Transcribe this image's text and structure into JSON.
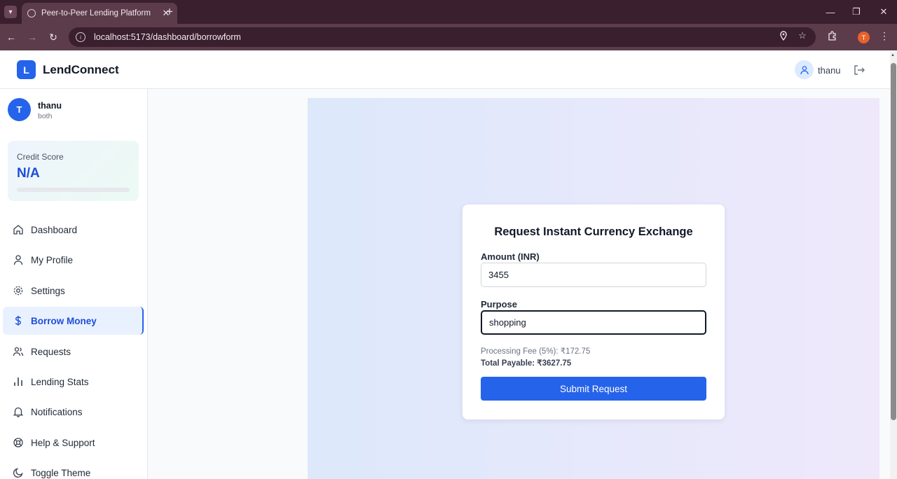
{
  "browser": {
    "tab_title": "Peer-to-Peer Lending Platform",
    "url": "localhost:5173/dashboard/borrowform",
    "profile_initial": "T"
  },
  "header": {
    "logo_letter": "L",
    "brand": "LendConnect",
    "user_name": "thanu"
  },
  "sidebar": {
    "avatar_initial": "T",
    "user_name": "thanu",
    "user_role": "both",
    "credit": {
      "label": "Credit Score",
      "value": "N/A",
      "progress": 0
    },
    "items": [
      {
        "label": "Dashboard",
        "icon": "home-icon"
      },
      {
        "label": "My Profile",
        "icon": "user-icon"
      },
      {
        "label": "Settings",
        "icon": "gear-icon"
      },
      {
        "label": "Borrow Money",
        "icon": "dollar-icon",
        "active": true
      },
      {
        "label": "Requests",
        "icon": "users-icon"
      },
      {
        "label": "Lending Stats",
        "icon": "bar-chart-icon"
      },
      {
        "label": "Notifications",
        "icon": "bell-icon"
      },
      {
        "label": "Help & Support",
        "icon": "lifebuoy-icon"
      },
      {
        "label": "Toggle Theme",
        "icon": "moon-icon"
      }
    ]
  },
  "form": {
    "title": "Request Instant Currency Exchange",
    "amount_label": "Amount (INR)",
    "amount_value": "3455",
    "purpose_label": "Purpose",
    "purpose_value": "shopping",
    "fee_text": "Processing Fee (5%): ₹172.75",
    "total_text": "Total Payable: ₹3627.75",
    "submit_label": "Submit Request"
  },
  "colors": {
    "accent": "#2563eb",
    "browser_frame": "#3a1f2e"
  }
}
